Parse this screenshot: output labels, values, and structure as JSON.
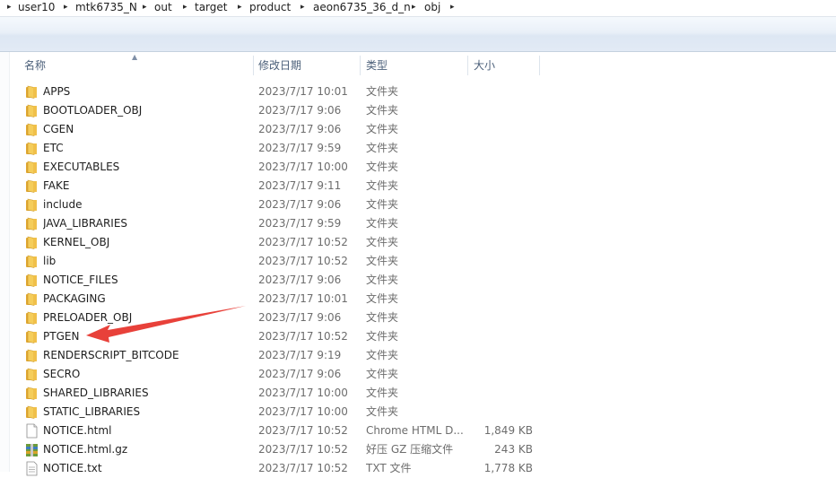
{
  "breadcrumb": [
    "user10",
    "mtk6735_N",
    "out",
    "target",
    "product",
    "aeon6735_36_d_n",
    "obj"
  ],
  "columns": {
    "name": "名称",
    "date": "修改日期",
    "type": "类型",
    "size": "大小"
  },
  "rows": [
    {
      "icon": "folder-icon",
      "name": "APPS",
      "date": "2023/7/17 10:01",
      "type": "文件夹",
      "size": ""
    },
    {
      "icon": "folder-icon",
      "name": "BOOTLOADER_OBJ",
      "date": "2023/7/17 9:06",
      "type": "文件夹",
      "size": ""
    },
    {
      "icon": "folder-icon",
      "name": "CGEN",
      "date": "2023/7/17 9:06",
      "type": "文件夹",
      "size": ""
    },
    {
      "icon": "folder-icon",
      "name": "ETC",
      "date": "2023/7/17 9:59",
      "type": "文件夹",
      "size": ""
    },
    {
      "icon": "folder-icon",
      "name": "EXECUTABLES",
      "date": "2023/7/17 10:00",
      "type": "文件夹",
      "size": ""
    },
    {
      "icon": "folder-icon",
      "name": "FAKE",
      "date": "2023/7/17 9:11",
      "type": "文件夹",
      "size": ""
    },
    {
      "icon": "folder-icon",
      "name": "include",
      "date": "2023/7/17 9:06",
      "type": "文件夹",
      "size": ""
    },
    {
      "icon": "folder-icon",
      "name": "JAVA_LIBRARIES",
      "date": "2023/7/17 9:59",
      "type": "文件夹",
      "size": ""
    },
    {
      "icon": "folder-icon",
      "name": "KERNEL_OBJ",
      "date": "2023/7/17 10:52",
      "type": "文件夹",
      "size": ""
    },
    {
      "icon": "folder-icon",
      "name": "lib",
      "date": "2023/7/17 10:52",
      "type": "文件夹",
      "size": ""
    },
    {
      "icon": "folder-icon",
      "name": "NOTICE_FILES",
      "date": "2023/7/17 9:06",
      "type": "文件夹",
      "size": ""
    },
    {
      "icon": "folder-icon",
      "name": "PACKAGING",
      "date": "2023/7/17 10:01",
      "type": "文件夹",
      "size": ""
    },
    {
      "icon": "folder-icon",
      "name": "PRELOADER_OBJ",
      "date": "2023/7/17 9:06",
      "type": "文件夹",
      "size": ""
    },
    {
      "icon": "folder-icon",
      "name": "PTGEN",
      "date": "2023/7/17 10:52",
      "type": "文件夹",
      "size": ""
    },
    {
      "icon": "folder-icon",
      "name": "RENDERSCRIPT_BITCODE",
      "date": "2023/7/17 9:19",
      "type": "文件夹",
      "size": ""
    },
    {
      "icon": "folder-icon",
      "name": "SECRO",
      "date": "2023/7/17 9:06",
      "type": "文件夹",
      "size": ""
    },
    {
      "icon": "folder-icon",
      "name": "SHARED_LIBRARIES",
      "date": "2023/7/17 10:00",
      "type": "文件夹",
      "size": ""
    },
    {
      "icon": "folder-icon",
      "name": "STATIC_LIBRARIES",
      "date": "2023/7/17 10:00",
      "type": "文件夹",
      "size": ""
    },
    {
      "icon": "html-file-icon",
      "name": "NOTICE.html",
      "date": "2023/7/17 10:52",
      "type": "Chrome HTML D...",
      "size": "1,849 KB"
    },
    {
      "icon": "archive-file-icon",
      "name": "NOTICE.html.gz",
      "date": "2023/7/17 10:52",
      "type": "好压 GZ 压缩文件",
      "size": "243 KB"
    },
    {
      "icon": "text-file-icon",
      "name": "NOTICE.txt",
      "date": "2023/7/17 10:52",
      "type": "TXT 文件",
      "size": "1,778 KB"
    }
  ],
  "colors": {
    "annotation_arrow": "#e8413a",
    "folder": "#f2c24b",
    "header_text": "#4c607a"
  }
}
